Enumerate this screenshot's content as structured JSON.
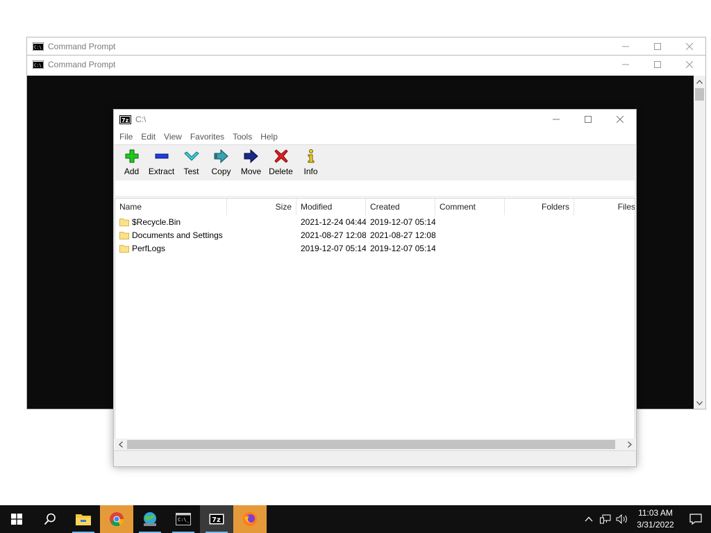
{
  "cmd_window_back": {
    "title": "Command Prompt"
  },
  "cmd_window_front": {
    "title": "Command Prompt"
  },
  "zip_window": {
    "title": "C:\\",
    "menu": [
      "File",
      "Edit",
      "View",
      "Favorites",
      "Tools",
      "Help"
    ],
    "toolbar": [
      {
        "label": "Add",
        "icon": "plus-icon"
      },
      {
        "label": "Extract",
        "icon": "minus-icon"
      },
      {
        "label": "Test",
        "icon": "check-icon"
      },
      {
        "label": "Copy",
        "icon": "copy-arrow-icon"
      },
      {
        "label": "Move",
        "icon": "move-arrow-icon"
      },
      {
        "label": "Delete",
        "icon": "delete-x-icon"
      },
      {
        "label": "Info",
        "icon": "info-icon"
      }
    ],
    "columns": {
      "name": "Name",
      "size": "Size",
      "modified": "Modified",
      "created": "Created",
      "comment": "Comment",
      "folders": "Folders",
      "files": "Files"
    },
    "rows": [
      {
        "name": "$Recycle.Bin",
        "size": "",
        "modified": "2021-12-24 04:44",
        "created": "2019-12-07 05:14",
        "comment": "",
        "folders": ""
      },
      {
        "name": "Documents and Settings",
        "size": "",
        "modified": "2021-08-27 12:08",
        "created": "2021-08-27 12:08",
        "comment": "",
        "folders": ""
      },
      {
        "name": "PerfLogs",
        "size": "",
        "modified": "2019-12-07 05:14",
        "created": "2019-12-07 05:14",
        "comment": "",
        "folders": ""
      }
    ]
  },
  "taskbar": {
    "items": [
      "windows-start-icon",
      "search-icon",
      "file-explorer-icon",
      "chrome-icon",
      "network-globe-icon",
      "command-prompt-icon",
      "7zip-icon",
      "firefox-icon"
    ],
    "clock": {
      "time": "11:03 AM",
      "date": "3/31/2022"
    }
  },
  "colors": {
    "taskbar_bg": "#101010",
    "console_bg": "#0c0c0c",
    "toolbar_bg": "#f0f0f0",
    "highlight_orange": "#e59a3a"
  }
}
